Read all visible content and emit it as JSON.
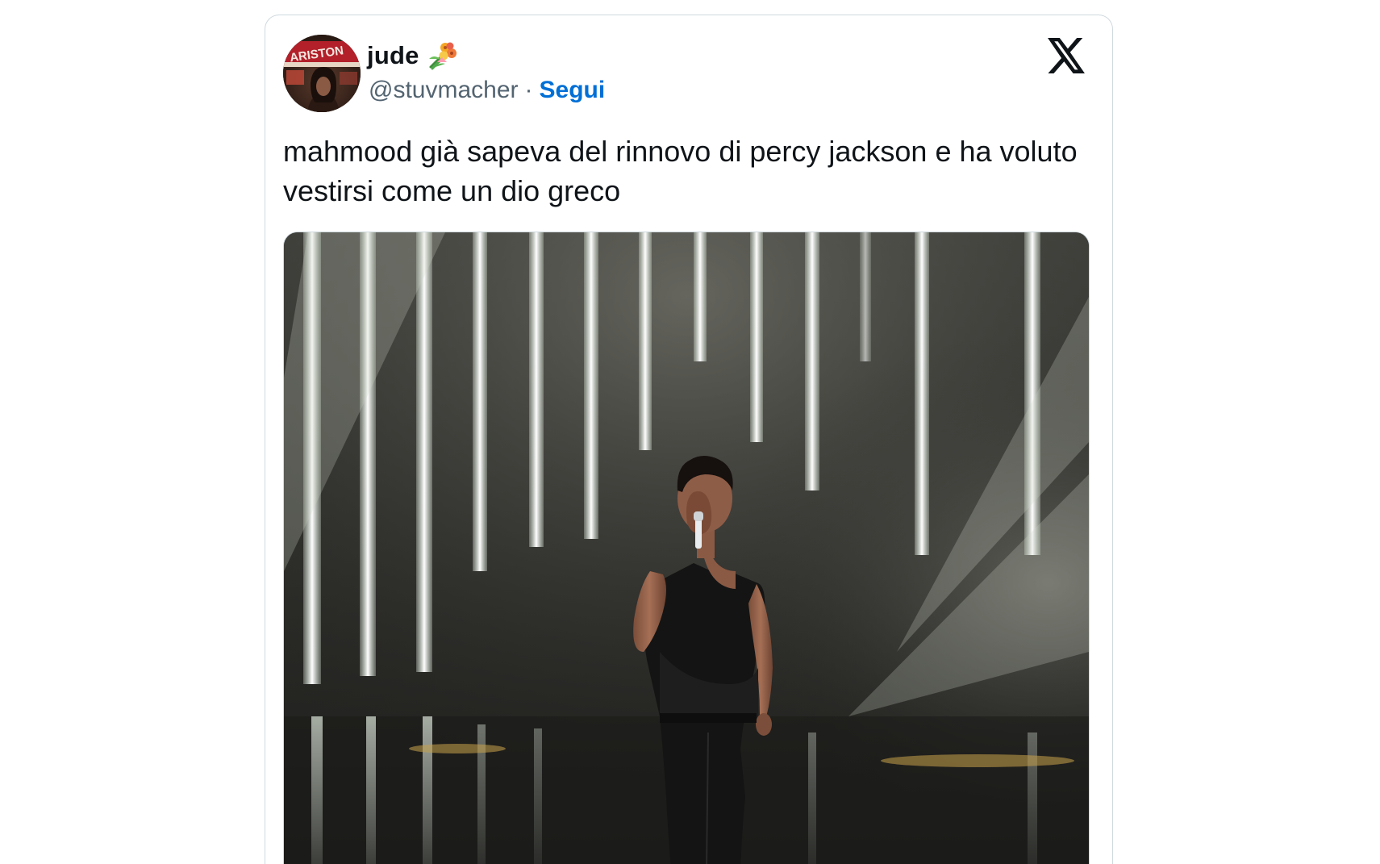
{
  "tweet": {
    "author": {
      "display_name": "jude",
      "name_emoji_icon": "bouquet-icon",
      "handle": "@stuvmacher",
      "separator": "·",
      "follow_label": "Segui",
      "avatar_sign_text": "ARISTON"
    },
    "platform_logo_icon": "x-logo-icon",
    "text": "mahmood già sapeva del rinnovo di percy jackson e ha voluto vestirsi come un dio greco",
    "media": {
      "kind": "photo",
      "subject": "performer-on-stage"
    }
  },
  "colors": {
    "link": "#006fd6",
    "text_primary": "#0f1419",
    "text_secondary": "#536471",
    "border": "#cfd9de"
  }
}
